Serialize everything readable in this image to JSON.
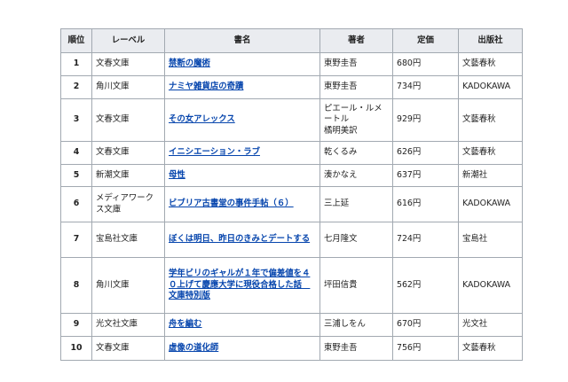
{
  "table": {
    "headers": {
      "rank": "順位",
      "label": "レーベル",
      "title": "書名",
      "author": "著者",
      "price": "定価",
      "publisher": "出版社"
    },
    "rows": [
      {
        "rank": "1",
        "label": "文春文庫",
        "title": "禁断の魔術",
        "author": "東野圭吾",
        "price": "680円",
        "publisher": "文藝春秋"
      },
      {
        "rank": "2",
        "label": "角川文庫",
        "title": "ナミヤ雑貨店の奇蹟",
        "author": "東野圭吾",
        "price": "734円",
        "publisher": "KADOKAWA"
      },
      {
        "rank": "3",
        "label": "文春文庫",
        "title": "その女アレックス",
        "author": "ピエール・ルメートル\n橘明美訳",
        "price": "929円",
        "publisher": "文藝春秋"
      },
      {
        "rank": "4",
        "label": "文春文庫",
        "title": "イニシエーション・ラブ",
        "author": "乾くるみ",
        "price": "626円",
        "publisher": "文藝春秋"
      },
      {
        "rank": "5",
        "label": "新潮文庫",
        "title": "母性",
        "author": "湊かなえ",
        "price": "637円",
        "publisher": "新潮社"
      },
      {
        "rank": "6",
        "label": "メディアワークス文庫",
        "title": "ビブリア古書堂の事件手帖（６）",
        "author": "三上延",
        "price": "616円",
        "publisher": "KADOKAWA"
      },
      {
        "rank": "7",
        "label": "宝島社文庫",
        "title": "ぼくは明日、昨日のきみとデートする",
        "author": "七月隆文",
        "price": "724円",
        "publisher": "宝島社"
      },
      {
        "rank": "8",
        "label": "角川文庫",
        "title": "学年ビリのギャルが１年で偏差値を４０上げて慶應大学に現役合格した話　文庫特別版",
        "author": "坪田信貴",
        "price": "562円",
        "publisher": "KADOKAWA"
      },
      {
        "rank": "9",
        "label": "光文社文庫",
        "title": "舟を編む",
        "author": "三浦しをん",
        "price": "670円",
        "publisher": "光文社"
      },
      {
        "rank": "10",
        "label": "文春文庫",
        "title": "虚像の道化師",
        "author": "東野圭吾",
        "price": "756円",
        "publisher": "文藝春秋"
      }
    ]
  }
}
